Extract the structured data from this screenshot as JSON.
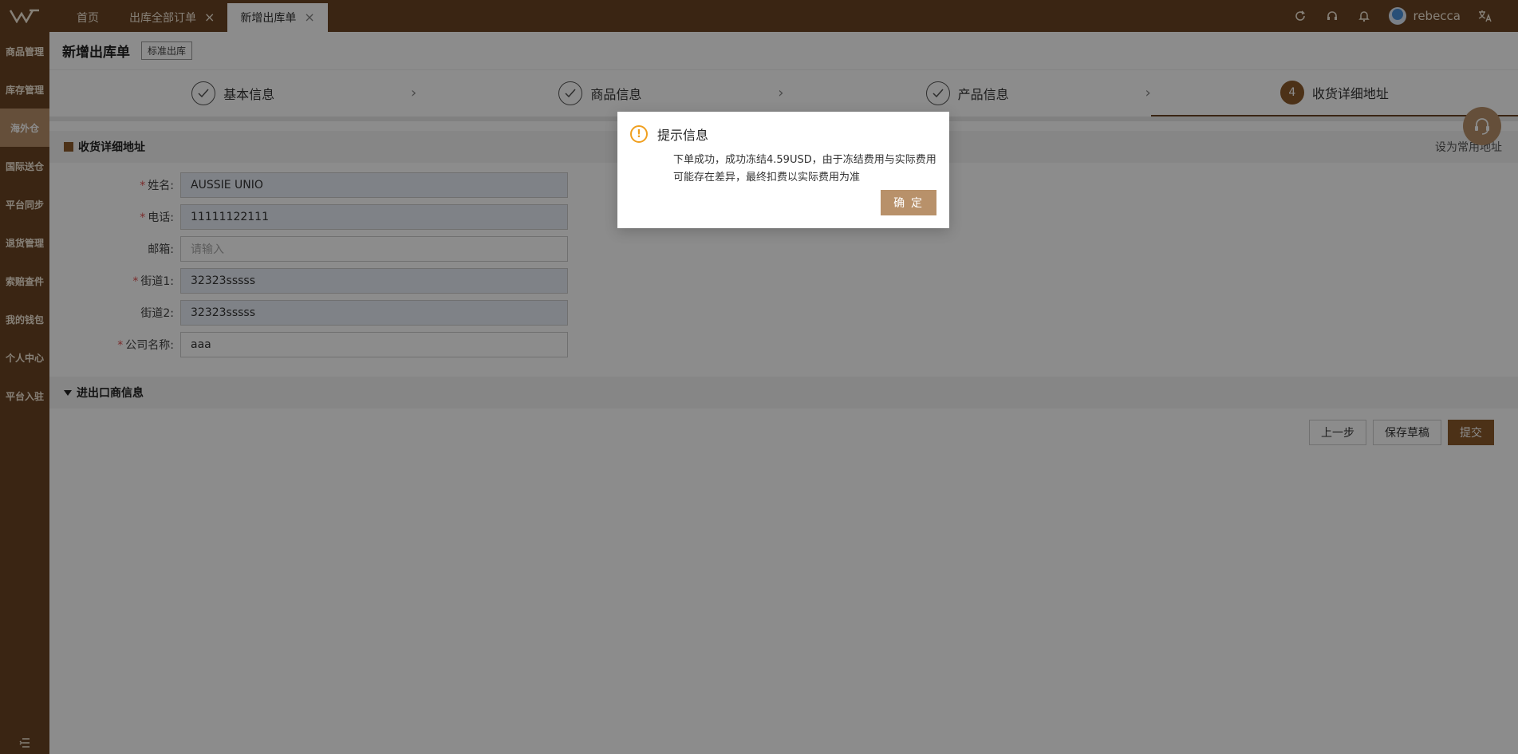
{
  "header": {
    "tabs": [
      {
        "label": "首页"
      },
      {
        "label": "出库全部订单",
        "close": "×"
      },
      {
        "label": "新增出库单",
        "close": "×"
      }
    ],
    "username": "rebecca"
  },
  "sidebar": {
    "items": [
      {
        "label": "商品管理"
      },
      {
        "label": "库存管理"
      },
      {
        "label": "海外仓"
      },
      {
        "label": "国际送仓"
      },
      {
        "label": "平台同步"
      },
      {
        "label": "退货管理"
      },
      {
        "label": "索赔查件"
      },
      {
        "label": "我的钱包"
      },
      {
        "label": "个人中心"
      },
      {
        "label": "平台入驻"
      }
    ]
  },
  "page": {
    "title": "新增出库单",
    "tag": "标准出库"
  },
  "steps": [
    {
      "label": "基本信息",
      "state": "done"
    },
    {
      "label": "商品信息",
      "state": "done"
    },
    {
      "label": "产品信息",
      "state": "done"
    },
    {
      "label": "收货详细地址",
      "number": "4",
      "state": "current"
    }
  ],
  "address_section": {
    "title": "收货详细地址",
    "set_default": "设为常用地址",
    "fields": [
      {
        "label": "姓名:",
        "value": "AUSSIE UNIO",
        "required": "*"
      },
      {
        "label": "电话:",
        "value": "11111122111",
        "required": "*"
      },
      {
        "label": "邮箱:",
        "placeholder": "请输入"
      },
      {
        "label": "街道1:",
        "value": "32323sssss",
        "required": "*"
      },
      {
        "label": "街道2:",
        "value": "32323sssss"
      },
      {
        "label": "公司名称:",
        "value": "aaa",
        "required": "*"
      }
    ]
  },
  "importer_section": {
    "title": "进出口商信息"
  },
  "actions": {
    "prev": "上一步",
    "save_draft": "保存草稿",
    "submit": "提交"
  },
  "dialog": {
    "icon_text": "!",
    "title": "提示信息",
    "message": "下单成功，成功冻结4.59USD，由于冻结费用与实际费用可能存在差异，最终扣费以实际费用为准",
    "ok": "确 定"
  },
  "colors": {
    "brand_brown": "#6b4423",
    "accent_tan": "#b8916a",
    "warning": "#f0a020"
  },
  "icons": [
    "logo-icon",
    "refresh-icon",
    "headset-icon",
    "bell-icon",
    "translate-icon",
    "help-fab-icon",
    "collapse-menu-icon",
    "warning-icon"
  ]
}
